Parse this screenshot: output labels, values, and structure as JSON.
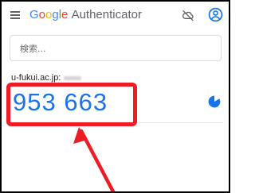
{
  "app": {
    "title_brand_letters": [
      "G",
      "o",
      "o",
      "g",
      "l",
      "e"
    ],
    "title_rest": "Authenticator",
    "brand_colors": [
      "#4285f4",
      "#ea4335",
      "#fbbc05",
      "#4285f4",
      "#34a853",
      "#ea4335"
    ]
  },
  "toolbar": {
    "menu_icon": "hamburger-menu-icon",
    "sync_icon": "cloud-sync-off-icon",
    "account_icon": "account-circle-icon",
    "icon_color": "#5f6368",
    "account_icon_color": "#1a73e8"
  },
  "search": {
    "placeholder": "検索..."
  },
  "accounts": [
    {
      "label": "u-fukui.ac.jp:",
      "code": "953 663",
      "code_color": "#1a73e8",
      "timer_icon": "countdown-timer-icon"
    }
  ],
  "annotation": {
    "color": "#ee1c25",
    "shape": "highlight-box-with-arrow"
  }
}
